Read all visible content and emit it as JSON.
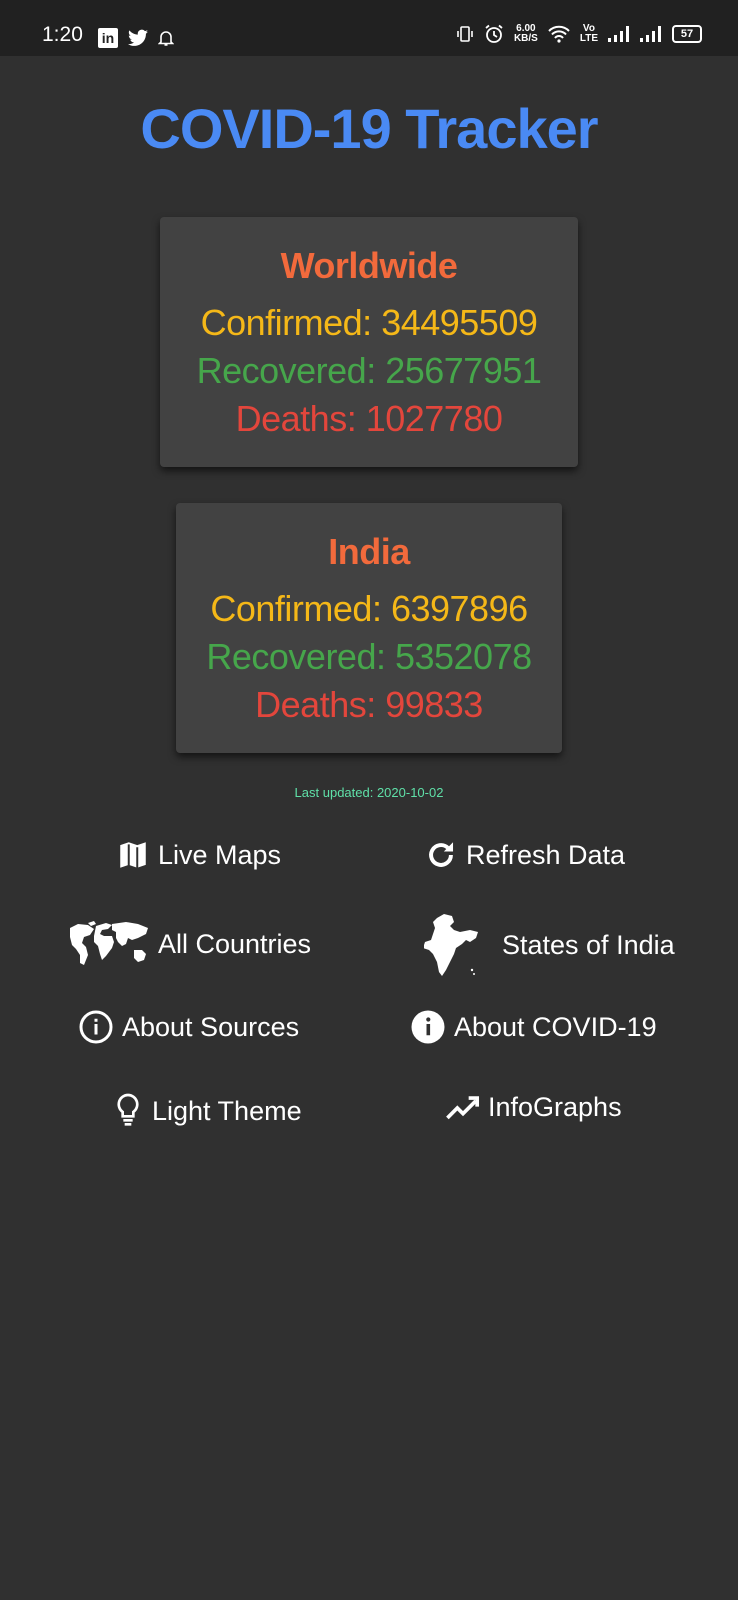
{
  "status_bar": {
    "time": "1:20",
    "app_icons": [
      "linkedin-icon",
      "twitter-icon",
      "bell-icon"
    ],
    "net_speed_value": "6.00",
    "net_speed_unit": "KB/S",
    "volte_line1": "Vo",
    "volte_line2": "LTE",
    "battery": "57"
  },
  "app": {
    "title": "COVID-19 Tracker",
    "title_color": "#4a8af4"
  },
  "worldwide": {
    "title": "Worldwide",
    "confirmed": "Confirmed: 34495509",
    "recovered": "Recovered: 25677951",
    "deaths": "Deaths: 1027780"
  },
  "india": {
    "title": "India",
    "confirmed": "Confirmed: 6397896",
    "recovered": "Recovered: 5352078",
    "deaths": "Deaths: 99833"
  },
  "last_updated": "Last updated: 2020-10-02",
  "menu": {
    "live_maps": {
      "label": "Live Maps",
      "icon": "map-icon"
    },
    "refresh_data": {
      "label": "Refresh Data",
      "icon": "refresh-icon"
    },
    "all_countries": {
      "label": "All Countries",
      "icon": "world-map-icon"
    },
    "states_of_india": {
      "label": "States of India",
      "icon": "india-map-icon"
    },
    "about_sources": {
      "label": "About Sources",
      "icon": "info-outline-icon"
    },
    "about_covid": {
      "label": "About COVID-19",
      "icon": "info-filled-icon"
    },
    "light_theme": {
      "label": "Light Theme",
      "icon": "lightbulb-icon"
    },
    "infographs": {
      "label": "InfoGraphs",
      "icon": "trending-icon"
    }
  },
  "colors": {
    "background": "#303030",
    "card": "#424242",
    "card_title": "#f26a3c",
    "confirmed": "#f5b818",
    "recovered": "#46a64b",
    "deaths": "#e3463c",
    "updated": "#5fe0a8"
  }
}
